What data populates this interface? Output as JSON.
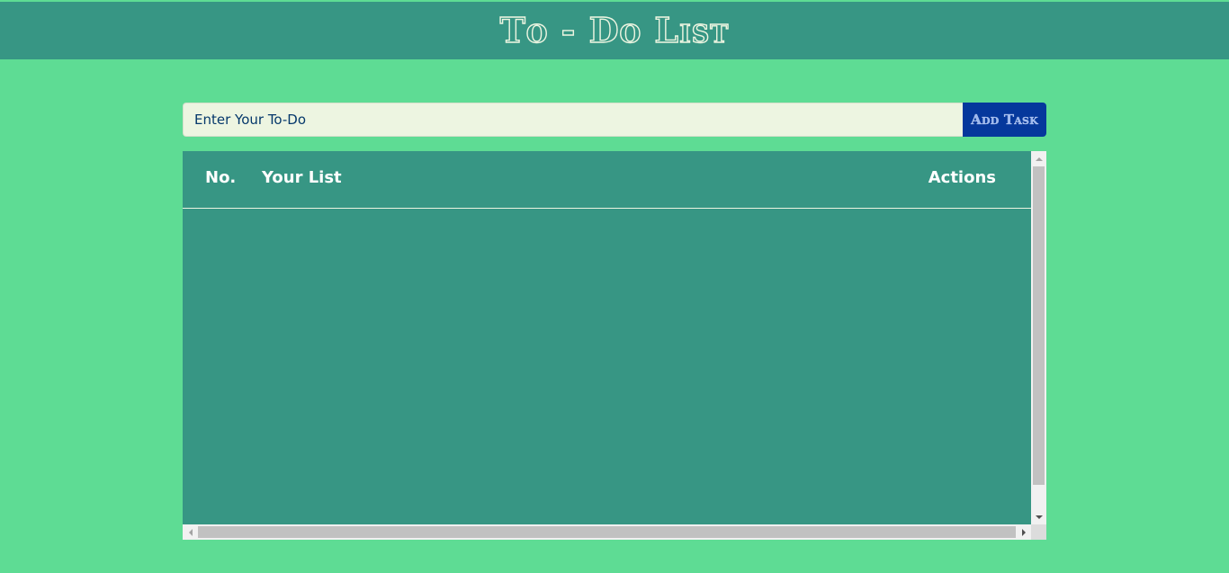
{
  "header": {
    "title": "To - Do List"
  },
  "form": {
    "input_placeholder": "Enter Your To-Do",
    "input_value": "",
    "add_button_label": "Add Task"
  },
  "table": {
    "columns": {
      "number": "No.",
      "task": "Your List",
      "actions": "Actions"
    },
    "rows": []
  },
  "colors": {
    "page_background": "#5edc94",
    "header_background": "#379684",
    "input_background": "#edf5e1",
    "button_background": "#05389c",
    "text_accent": "#05386b"
  }
}
